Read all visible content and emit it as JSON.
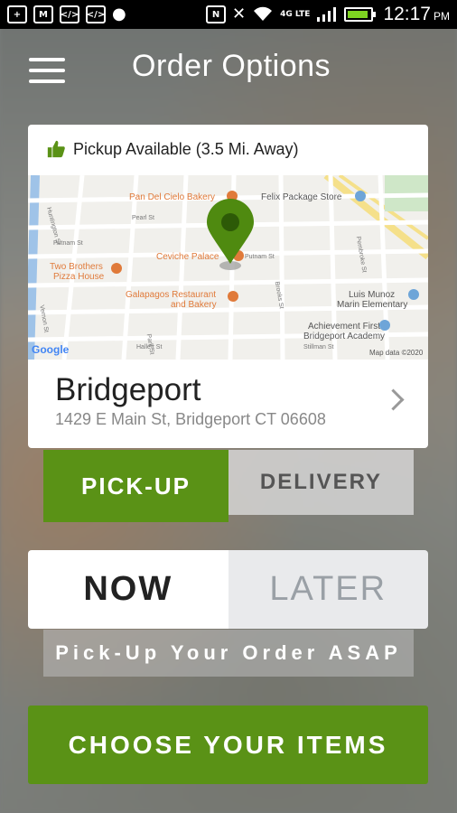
{
  "status_bar": {
    "time": "12:17",
    "ampm": "PM",
    "network": "4G LTE",
    "icons": [
      "plus-icon",
      "gmail-icon",
      "code-icon",
      "code-icon",
      "chat-icon",
      "nfc-icon",
      "mute-icon",
      "wifi-icon",
      "signal-icon",
      "battery-icon"
    ]
  },
  "header": {
    "title": "Order Options"
  },
  "store_card": {
    "availability": "Pickup Available (3.5 Mi. Away)",
    "store_name": "Bridgeport",
    "address": "1429 E Main St, Bridgeport CT 06608",
    "map": {
      "labels": {
        "bakery": "Pan Del Cielo Bakery",
        "felix": "Felix Package Store",
        "ceviche": "Ceviche Palace",
        "two_brothers_1": "Two Brothers",
        "two_brothers_2": "Pizza House",
        "galapagos_1": "Galapagos Restaurant",
        "galapagos_2": "and Bakery",
        "luis_1": "Luis Munoz",
        "luis_2": "Marin Elementary",
        "achievement_1": "Achievement First",
        "achievement_2": "Bridgeport Academy",
        "google": "Google",
        "map_data": "Map data ©2020",
        "pearl": "Pearl St",
        "putnam": "Putnam St",
        "vernon": "Vernon St",
        "hallett": "Hallett St",
        "stillman": "Stillman St",
        "park": "Park St",
        "huntington": "Huntington St",
        "brooks": "Brooks St",
        "pembroke": "Pembroke St"
      }
    }
  },
  "order_type": {
    "pickup": "PICK-UP",
    "delivery": "DELIVERY",
    "selected": "pickup"
  },
  "timing": {
    "now": "NOW",
    "later": "LATER",
    "selected": "now",
    "note": "Pick-Up Your Order ASAP"
  },
  "cta": {
    "label": "CHOOSE YOUR ITEMS"
  },
  "colors": {
    "brand_green": "#5a9216",
    "pin_green": "#4f8a10"
  }
}
